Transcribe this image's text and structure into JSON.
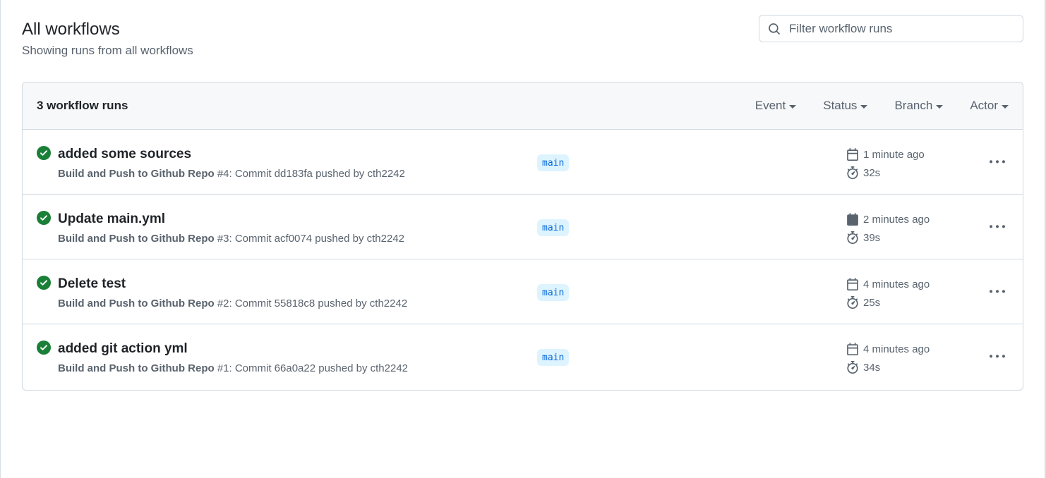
{
  "page": {
    "title": "All workflows",
    "subtitle": "Showing runs from all workflows"
  },
  "search": {
    "placeholder": "Filter workflow runs",
    "icon": "search-icon"
  },
  "runs_header": {
    "count_label": "3 workflow runs",
    "filters": [
      "Event",
      "Status",
      "Branch",
      "Actor"
    ]
  },
  "runs": [
    {
      "title": "added some sources",
      "workflow": "Build and Push to Github Repo",
      "run_number": "#4",
      "commit_text": ": Commit dd183fa pushed by cth2242",
      "branch": "main",
      "time_ago": "1 minute ago",
      "duration": "32s",
      "status": "success"
    },
    {
      "title": "Update main.yml",
      "workflow": "Build and Push to Github Repo",
      "run_number": "#3",
      "commit_text": ": Commit acf0074 pushed by cth2242",
      "branch": "main",
      "time_ago": "2 minutes ago",
      "duration": "39s",
      "status": "success"
    },
    {
      "title": "Delete test",
      "workflow": "Build and Push to Github Repo",
      "run_number": "#2",
      "commit_text": ": Commit 55818c8 pushed by cth2242",
      "branch": "main",
      "time_ago": "4 minutes ago",
      "duration": "25s",
      "status": "success"
    },
    {
      "title": "added git action yml",
      "workflow": "Build and Push to Github Repo",
      "run_number": "#1",
      "commit_text": ": Commit 66a0a22 pushed by cth2242",
      "branch": "main",
      "time_ago": "4 minutes ago",
      "duration": "34s",
      "status": "success"
    }
  ],
  "colors": {
    "success": "#1a7f37",
    "branch_bg": "#ddf4ff",
    "branch_fg": "#0969da",
    "muted": "#59636e",
    "border": "#d1d9e0"
  }
}
